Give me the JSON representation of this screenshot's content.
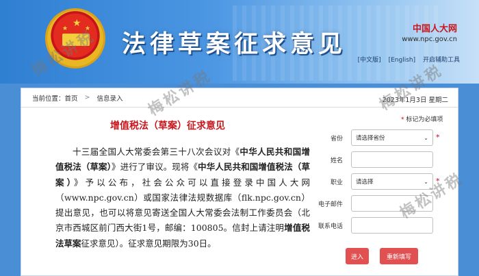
{
  "banner": {
    "title": "法律草案征求意见",
    "brand": "中国人大网",
    "url": "www.npc.gov.cn",
    "links": [
      "[中文版]",
      "[English]",
      "开启辅助工具"
    ]
  },
  "breadcrumb": {
    "prefix": "当前位置：",
    "home": "首页",
    "separator": ">",
    "current": "信息录入",
    "date": "2023年1月3日 星期二"
  },
  "document": {
    "title": "增值税法（草案）征求意见",
    "p1": "十三届全国人大常委会第三十八次会议对《",
    "b1": "中华人民共和国增值税法（草案）",
    "p2": "》进行了审议。现将《",
    "b2": "中华人民共和国增值税法（草案）",
    "p3": "》予以公布，社会公众可以直接登录中国人大网（www.npc.gov.cn）或国家法律法规数据库（flk.npc.gov.cn）提出意见，也可以将意见寄送全国人大常委会法制工作委员会（北京市西城区前门西大街1号，邮编：100805。信封上请注明",
    "b3": "增值税法草案",
    "p4": "征求意见）。征求意见期限为30日。"
  },
  "form": {
    "required_note": "标记为必填项",
    "required_mark": "*",
    "province_label": "省份",
    "province_value": "请选择省份",
    "name_label": "姓名",
    "job_label": "职业",
    "job_value": "请选择",
    "email_label": "电子邮件",
    "phone_label": "联系电话",
    "submit_label": "进入",
    "reset_label": "重新填写"
  },
  "watermark": "梅松讲税"
}
